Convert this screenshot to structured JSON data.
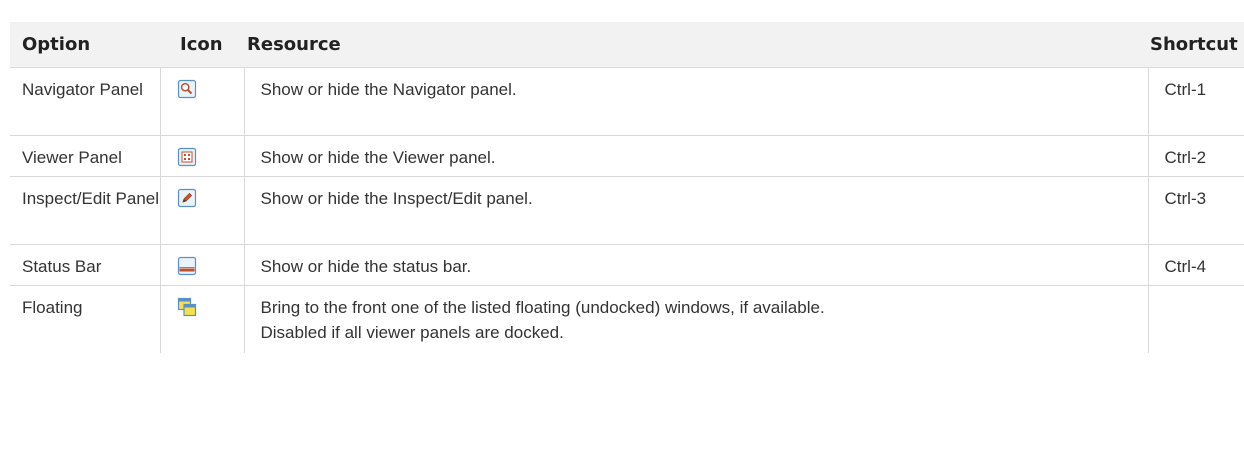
{
  "table": {
    "headers": {
      "option": "Option",
      "icon": "Icon",
      "resource": "Resource",
      "shortcut": "Shortcut"
    },
    "rows": [
      {
        "option": "Navigator Panel",
        "icon": "navigator-panel-icon",
        "resource": "Show or hide the Navigator panel.",
        "shortcut": "Ctrl-1"
      },
      {
        "option": "Viewer Panel",
        "icon": "viewer-panel-icon",
        "resource": "Show or hide the Viewer panel.",
        "shortcut": "Ctrl-2"
      },
      {
        "option": "Inspect/Edit Panel",
        "icon": "inspect-edit-panel-icon",
        "resource": "Show or hide the Inspect/Edit panel.",
        "shortcut": "Ctrl-3"
      },
      {
        "option": "Status Bar",
        "icon": "status-bar-icon",
        "resource": "Show or hide the status bar.",
        "shortcut": "Ctrl-4"
      },
      {
        "option": "Floating",
        "icon": "floating-windows-icon",
        "resource_lines": [
          "Bring to the front one of the listed floating (undocked) windows, if available.",
          "Disabled if all viewer panels are docked."
        ],
        "shortcut": ""
      }
    ]
  }
}
